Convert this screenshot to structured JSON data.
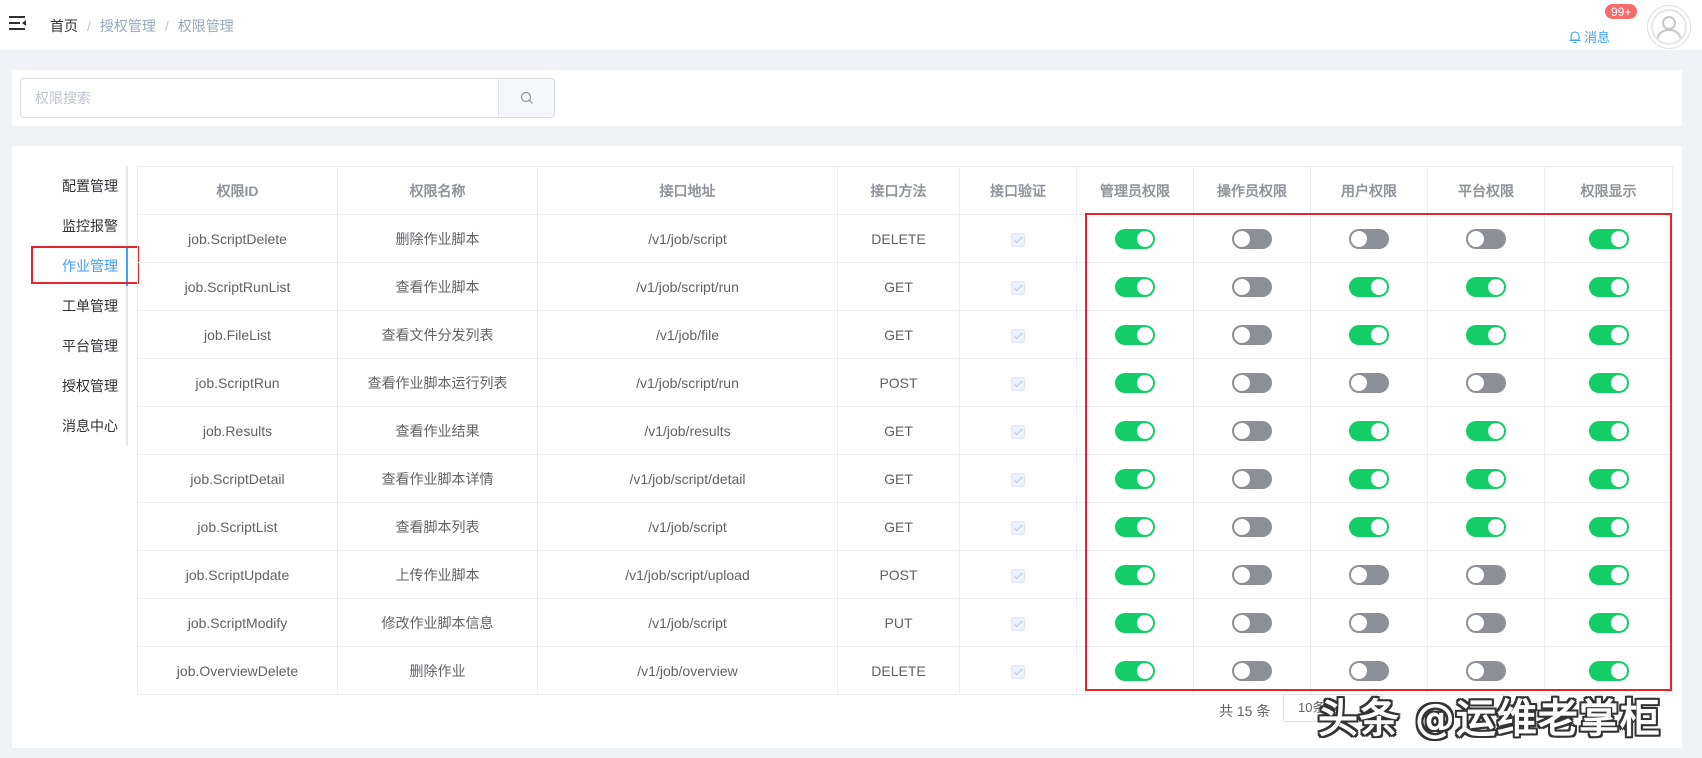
{
  "header": {
    "breadcrumb": [
      "首页",
      "授权管理",
      "权限管理"
    ],
    "notify_label": "消息",
    "badge": "99+"
  },
  "search": {
    "placeholder": "权限搜索",
    "value": ""
  },
  "side_tabs": [
    {
      "label": "配置管理",
      "active": false
    },
    {
      "label": "监控报警",
      "active": false
    },
    {
      "label": "作业管理",
      "active": true
    },
    {
      "label": "工单管理",
      "active": false
    },
    {
      "label": "平台管理",
      "active": false
    },
    {
      "label": "授权管理",
      "active": false
    },
    {
      "label": "消息中心",
      "active": false
    }
  ],
  "table": {
    "columns": [
      "权限ID",
      "权限名称",
      "接口地址",
      "接口方法",
      "接口验证",
      "管理员权限",
      "操作员权限",
      "用户权限",
      "平台权限",
      "权限显示"
    ],
    "rows": [
      {
        "id": "job.ScriptDelete",
        "name": "删除作业脚本",
        "path": "/v1/job/script",
        "method": "DELETE",
        "verified": true,
        "switches": [
          true,
          false,
          false,
          false,
          true
        ]
      },
      {
        "id": "job.ScriptRunList",
        "name": "查看作业脚本",
        "path": "/v1/job/script/run",
        "method": "GET",
        "verified": true,
        "switches": [
          true,
          false,
          true,
          true,
          true
        ]
      },
      {
        "id": "job.FileList",
        "name": "查看文件分发列表",
        "path": "/v1/job/file",
        "method": "GET",
        "verified": true,
        "switches": [
          true,
          false,
          true,
          true,
          true
        ]
      },
      {
        "id": "job.ScriptRun",
        "name": "查看作业脚本运行列表",
        "path": "/v1/job/script/run",
        "method": "POST",
        "verified": true,
        "switches": [
          true,
          false,
          false,
          false,
          true
        ]
      },
      {
        "id": "job.Results",
        "name": "查看作业结果",
        "path": "/v1/job/results",
        "method": "GET",
        "verified": true,
        "switches": [
          true,
          false,
          true,
          true,
          true
        ]
      },
      {
        "id": "job.ScriptDetail",
        "name": "查看作业脚本详情",
        "path": "/v1/job/script/detail",
        "method": "GET",
        "verified": true,
        "switches": [
          true,
          false,
          true,
          true,
          true
        ]
      },
      {
        "id": "job.ScriptList",
        "name": "查看脚本列表",
        "path": "/v1/job/script",
        "method": "GET",
        "verified": true,
        "switches": [
          true,
          false,
          true,
          true,
          true
        ]
      },
      {
        "id": "job.ScriptUpdate",
        "name": "上传作业脚本",
        "path": "/v1/job/script/upload",
        "method": "POST",
        "verified": true,
        "switches": [
          true,
          false,
          false,
          false,
          true
        ]
      },
      {
        "id": "job.ScriptModify",
        "name": "修改作业脚本信息",
        "path": "/v1/job/script",
        "method": "PUT",
        "verified": true,
        "switches": [
          true,
          false,
          false,
          false,
          true
        ]
      },
      {
        "id": "job.OverviewDelete",
        "name": "删除作业",
        "path": "/v1/job/overview",
        "method": "DELETE",
        "verified": true,
        "switches": [
          true,
          false,
          false,
          false,
          true
        ]
      }
    ]
  },
  "pagination": {
    "total": "共 15 条",
    "page_size": "10条"
  },
  "watermark": "头条 @运维老掌柜",
  "colors": {
    "switch_on": "#13ce66",
    "switch_off": "#8c8f96",
    "accent": "#409eff",
    "highlight_box": "#e0262d"
  }
}
